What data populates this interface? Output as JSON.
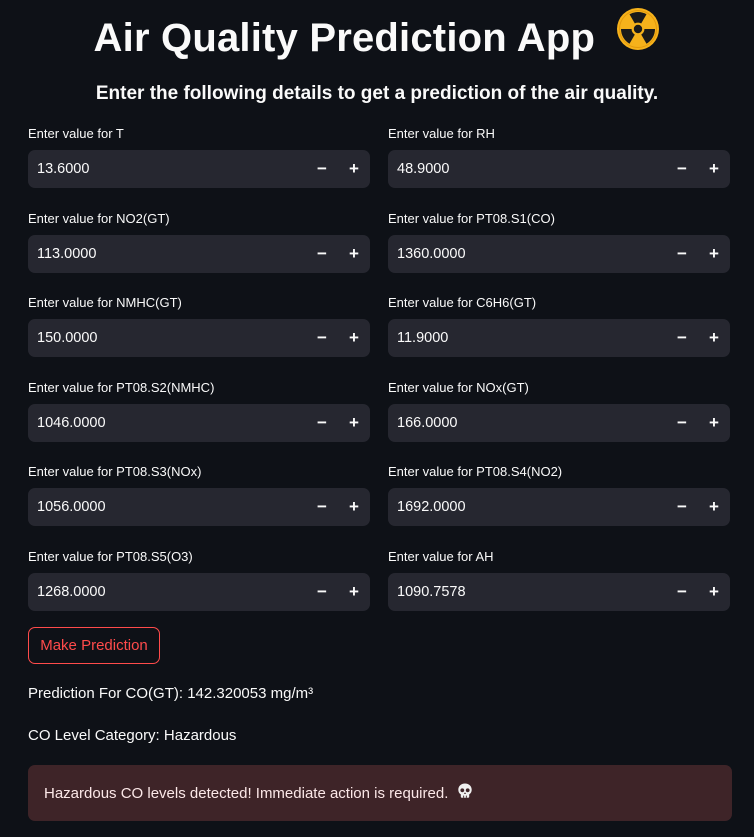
{
  "header": {
    "title": "Air Quality Prediction App",
    "title_icon": "radioactive-icon",
    "subtitle": "Enter the following details to get a prediction of the air quality."
  },
  "fields": [
    {
      "label": "Enter value for T",
      "value": "13.6000"
    },
    {
      "label": "Enter value for RH",
      "value": "48.9000"
    },
    {
      "label": "Enter value for NO2(GT)",
      "value": "113.0000"
    },
    {
      "label": "Enter value for PT08.S1(CO)",
      "value": "1360.0000"
    },
    {
      "label": "Enter value for NMHC(GT)",
      "value": "150.0000"
    },
    {
      "label": "Enter value for C6H6(GT)",
      "value": "11.9000"
    },
    {
      "label": "Enter value for PT08.S2(NMHC)",
      "value": "1046.0000"
    },
    {
      "label": "Enter value for NOx(GT)",
      "value": "166.0000"
    },
    {
      "label": "Enter value for PT08.S3(NOx)",
      "value": "1056.0000"
    },
    {
      "label": "Enter value for PT08.S4(NO2)",
      "value": "1692.0000"
    },
    {
      "label": "Enter value for PT08.S5(O3)",
      "value": "1268.0000"
    },
    {
      "label": "Enter value for AH",
      "value": "1090.7578"
    }
  ],
  "stepper": {
    "minus": "−",
    "plus": "+"
  },
  "predict_button": "Make Prediction",
  "result": {
    "prediction_text": "Prediction For CO(GT): 142.320053 mg/m³",
    "category_text": "CO Level Category: Hazardous"
  },
  "alert": {
    "message": "Hazardous CO levels detected! Immediate action is required.",
    "icon": "skull-icon"
  },
  "colors": {
    "background": "#0e1117",
    "input_bg": "#262730",
    "accent": "#ff4b4b",
    "alert_bg": "#3e2428",
    "radioactive_yellow": "#f6b21b"
  }
}
